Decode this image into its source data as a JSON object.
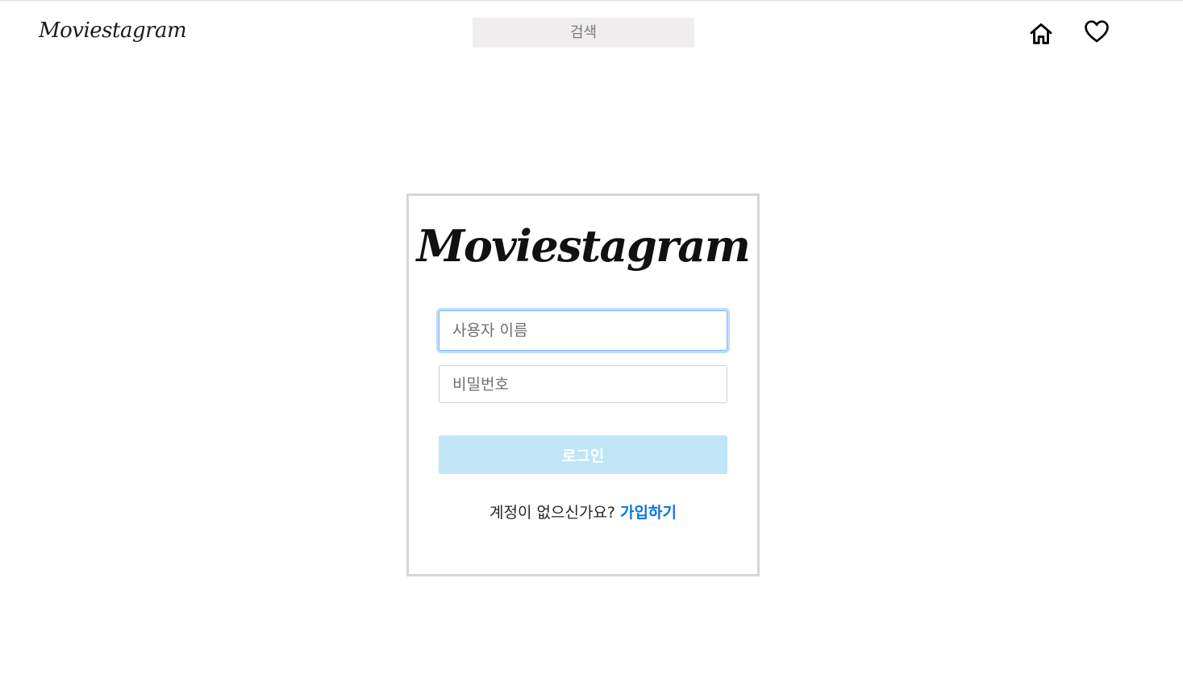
{
  "header": {
    "brand": "Moviestagram",
    "search_placeholder": "검색",
    "icons": [
      "home-icon",
      "heart-icon"
    ]
  },
  "login": {
    "logo": "Moviestagram",
    "username_placeholder": "사용자 이름",
    "password_placeholder": "비밀번호",
    "login_label": "로그인",
    "signup_prompt": "계정이 없으신가요? ",
    "signup_link": "가입하기"
  },
  "colors": {
    "accent_link": "#0a74e6",
    "login_button_disabled": "#bfe5f7",
    "search_bg": "#efedee"
  }
}
